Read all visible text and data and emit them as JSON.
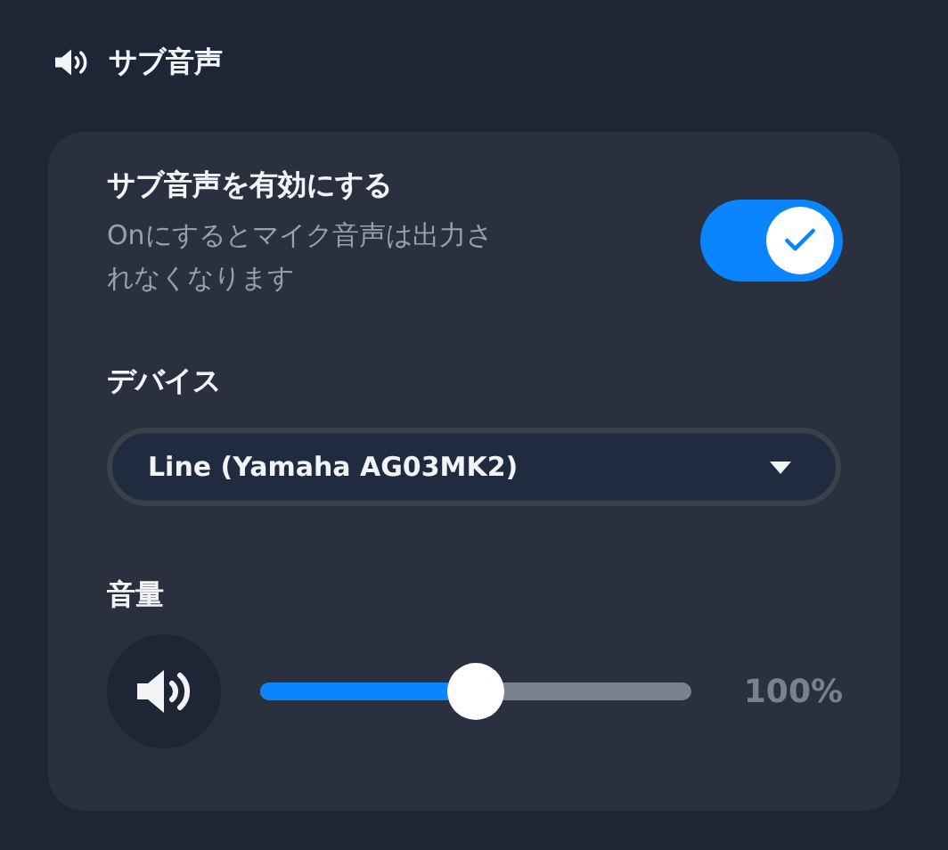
{
  "header": {
    "title": "サブ音声"
  },
  "enable": {
    "label": "サブ音声を有効にする",
    "description": "Onにするとマイク音声は出力されなくなります",
    "on": true
  },
  "device": {
    "label": "デバイス",
    "value": "Line (Yamaha AG03MK2)"
  },
  "volume": {
    "label": "音量",
    "level": 0.5,
    "reading": "100%"
  }
}
